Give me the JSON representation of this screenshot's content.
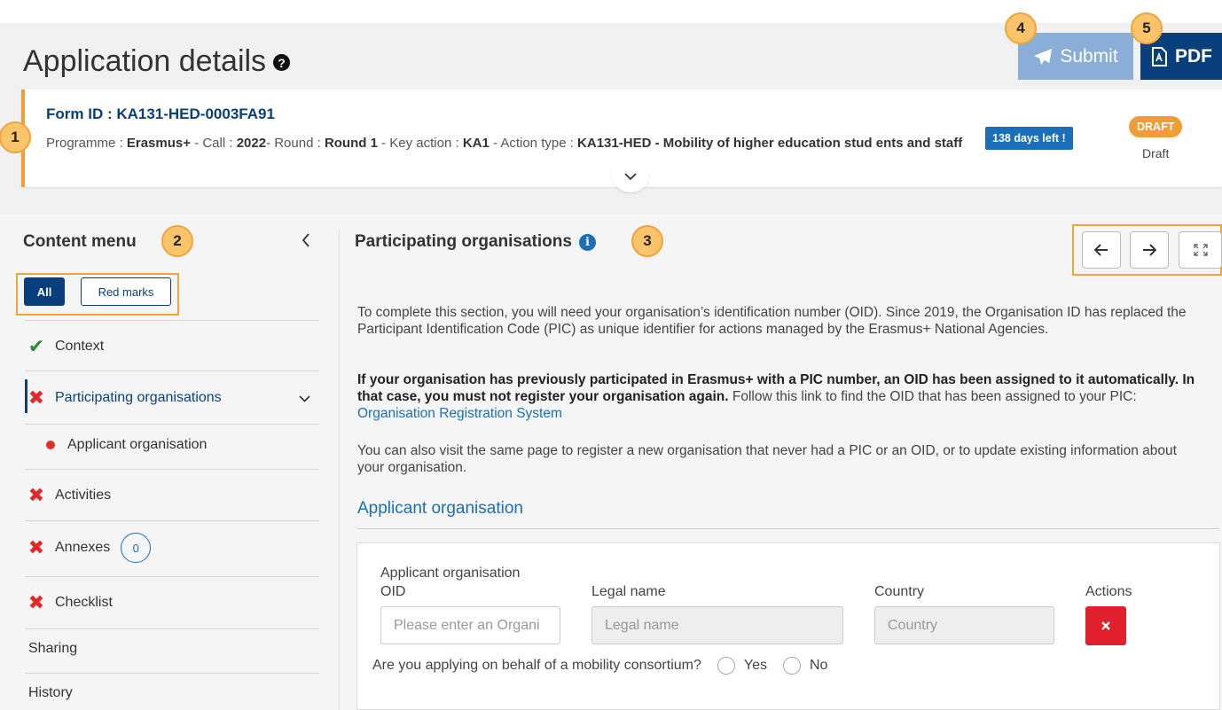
{
  "header": {
    "title": "Application details",
    "submit_label": "Submit",
    "pdf_label": "PDF"
  },
  "callouts": [
    "1",
    "2",
    "3",
    "4",
    "5"
  ],
  "form": {
    "id_line": "Form ID : KA131-HED-0003FA91",
    "programme_label": "Programme : ",
    "programme": "Erasmus+",
    "call_label": " - Call : ",
    "call": "2022",
    "round_label": "- Round : ",
    "round": "Round 1",
    "key_action_label": " - Key action : ",
    "key_action": "KA1",
    "action_type_label": " - Action type : ",
    "action_type": "KA131-HED - Mobility of higher education stud ents and staff",
    "days_left": "138 days left !",
    "status_pill": "DRAFT",
    "status_text": "Draft"
  },
  "sidebar": {
    "title": "Content menu",
    "filters": {
      "all": "All",
      "red_marks": "Red marks"
    },
    "items": [
      {
        "label": "Context",
        "state": "check"
      },
      {
        "label": "Participating organisations",
        "state": "error",
        "active": true
      },
      {
        "label": "Applicant organisation",
        "state": "dot"
      },
      {
        "label": "Activities",
        "state": "error"
      },
      {
        "label": "Annexes",
        "state": "error",
        "count": "0"
      },
      {
        "label": "Checklist",
        "state": "error"
      },
      {
        "label": "Sharing"
      },
      {
        "label": "History"
      }
    ]
  },
  "main": {
    "section_title": "Participating organisations",
    "para1": "To complete this section, you will need your organisation’s identification number (OID). Since 2019, the Organisation ID has replaced the Participant Identification Code (PIC) as unique identifier for actions managed by the Erasmus+ National Agencies.",
    "para2_bold": "If your organisation has previously participated in Erasmus+ with a PIC number, an OID has been assigned to it automatically. In that case, you must not register your organisation again.",
    "para2_rest": " Follow this link to find the OID that has been assigned to your PIC: ",
    "para2_link": "Organisation Registration System",
    "para3": "You can also visit the same page to register a new organisation that never had a PIC or an OID, or to update existing information about your organisation.",
    "subheading": "Applicant organisation",
    "table": {
      "col_oid_line1": "Applicant organisation",
      "col_oid_line2": "OID",
      "col_legal": "Legal name",
      "col_country": "Country",
      "col_actions": "Actions",
      "oid_placeholder": "Please enter an Organi",
      "legal_placeholder": "Legal name",
      "country_placeholder": "Country"
    },
    "consortium_question": "Are you applying on behalf of a mobility consortium?",
    "yes": "Yes",
    "no": "No"
  },
  "colors": {
    "primary": "#0a3f7d",
    "accent_blue": "#1a6fb8",
    "callout": "#fbc46a",
    "error": "#e02a2a",
    "success": "#2e8b3a",
    "draft": "#f29c38"
  }
}
